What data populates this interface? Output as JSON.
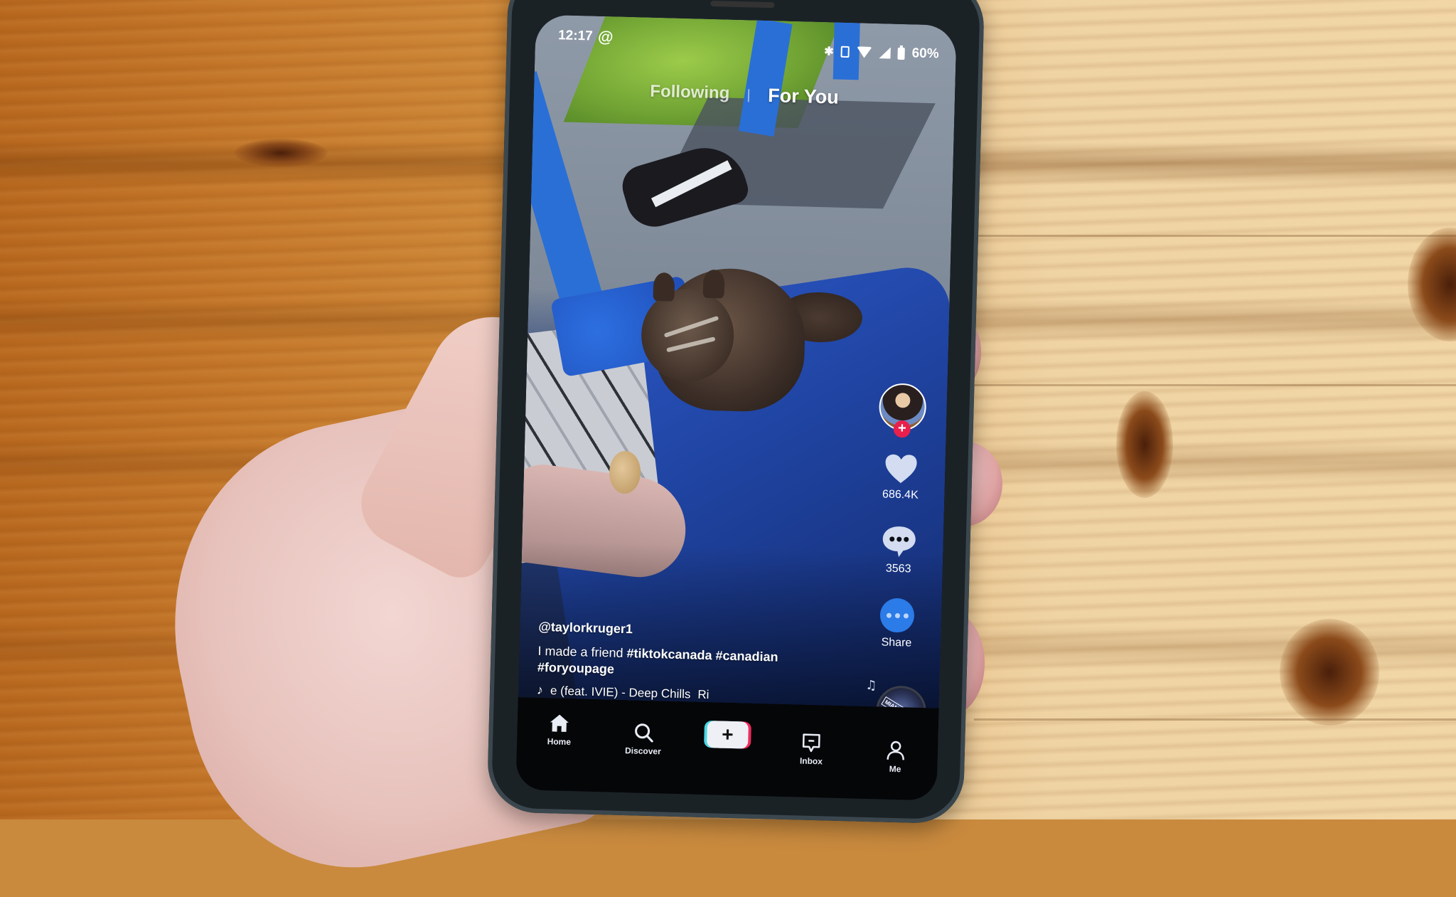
{
  "scene": {
    "description": "Photo of a hand holding an Android phone running TikTok over a wooden table"
  },
  "status_bar": {
    "time": "12:17",
    "notification_icon": "@",
    "icons": [
      "bluetooth-icon",
      "vibrate-icon",
      "wifi-icon",
      "signal-icon",
      "battery-icon"
    ],
    "battery_percent": "60%"
  },
  "feed_tabs": [
    {
      "label": "Following",
      "active": false
    },
    {
      "label": "For You",
      "active": true
    }
  ],
  "rail": {
    "follow_icon": "+",
    "likes": "686.4K",
    "comments": "3563",
    "share_label": "Share"
  },
  "caption": {
    "handle": "@taylorkruger1",
    "text": "I made a friend ",
    "hashtags": [
      "#tiktokcanada",
      "#canadian",
      "#foryoupage"
    ],
    "music": "e (feat. IVIE) - Deep Chills",
    "music_trailing": "Ri",
    "music_icon": "♪"
  },
  "disc": {
    "label": "MIAMI BEATS"
  },
  "bottom_nav": {
    "items": [
      {
        "label": "Home",
        "icon": "home-icon",
        "active": true
      },
      {
        "label": "Discover",
        "icon": "search-icon"
      },
      {
        "label": "+",
        "icon": "create-icon"
      },
      {
        "label": "Inbox",
        "icon": "inbox-icon"
      },
      {
        "label": "Me",
        "icon": "profile-icon"
      }
    ]
  },
  "colors": {
    "follow_red": "#e8204b",
    "share_blue": "#2b7be8",
    "create_cyan": "#47d8e6",
    "create_pink": "#ee2a5a"
  }
}
